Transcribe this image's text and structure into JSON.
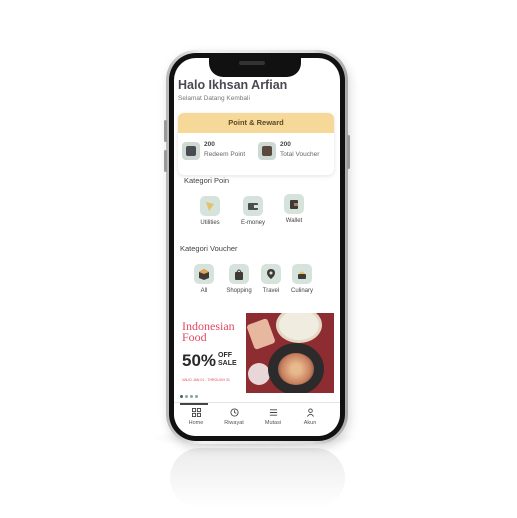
{
  "header": {
    "greeting": "Halo Ikhsan Arfian",
    "subtitle": "Selamat Datang Kembali"
  },
  "reward_card": {
    "title": "Point & Reward",
    "items": [
      {
        "value": "200",
        "label": "Redeem Point",
        "icon": "wallet-icon"
      },
      {
        "value": "200",
        "label": "Total Voucher",
        "icon": "voucher-icon"
      }
    ]
  },
  "kategori_poin": {
    "title": "Kategori Poin",
    "items": [
      {
        "label": "Utilities",
        "icon": "utilities-icon"
      },
      {
        "label": "E-money",
        "icon": "emoney-icon"
      },
      {
        "label": "Wallet",
        "icon": "wallet-icon"
      }
    ]
  },
  "kategori_voucher": {
    "title": "Kategori Voucher",
    "items": [
      {
        "label": "All",
        "icon": "box-icon"
      },
      {
        "label": "Shopping",
        "icon": "shopping-bag-icon"
      },
      {
        "label": "Travel",
        "icon": "location-pin-icon"
      },
      {
        "label": "Culinary",
        "icon": "food-icon"
      }
    ]
  },
  "banner": {
    "title": "Indonesian\nFood",
    "sale_percent": "50%",
    "sale_text": "OFF\nSALE",
    "date_text": "VALID JAN 01 - THROUGH 31"
  },
  "tabbar": {
    "items": [
      {
        "label": "Home",
        "icon": "grid-icon"
      },
      {
        "label": "Riwayat",
        "icon": "history-icon"
      },
      {
        "label": "Mutasi",
        "icon": "list-icon"
      },
      {
        "label": "Akun",
        "icon": "user-icon"
      }
    ]
  },
  "colors": {
    "accent_yellow": "#f6d998",
    "icon_bg": "#d6e3dc",
    "banner_red": "#e0495f"
  }
}
